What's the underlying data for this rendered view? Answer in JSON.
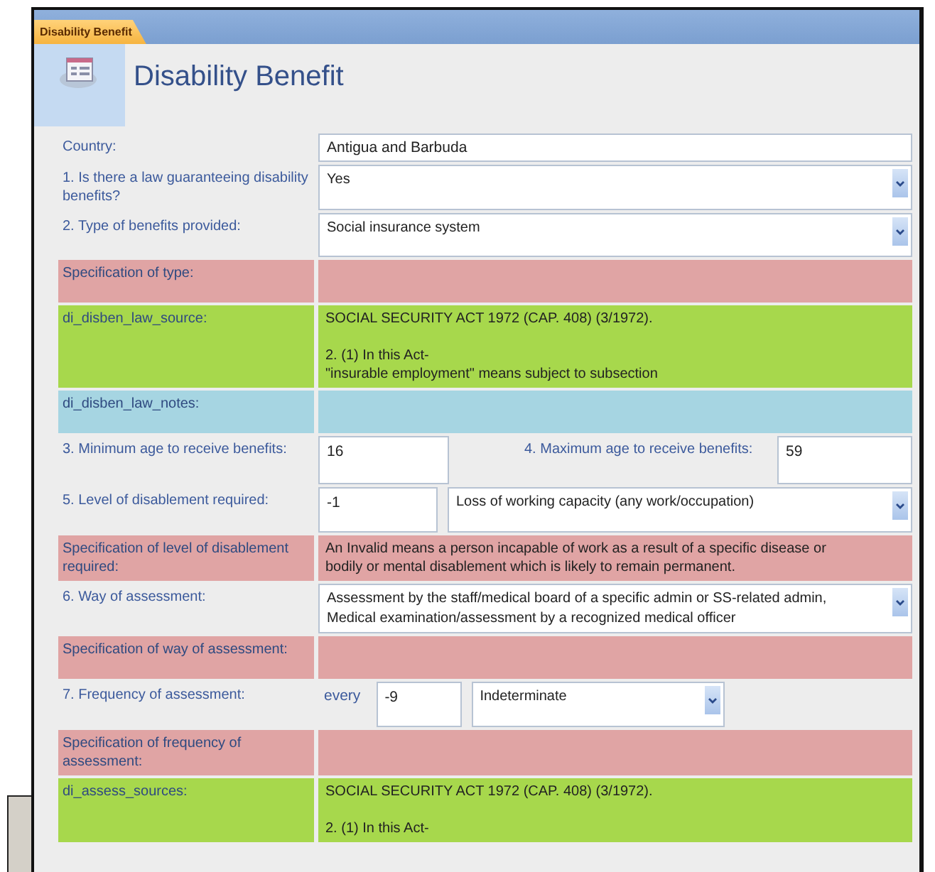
{
  "tab": {
    "label": "Disability Benefit",
    "selected": true
  },
  "form": {
    "title": "Disability Benefit"
  },
  "rows": [
    {
      "kind": "text",
      "label": "Country:",
      "value": "Antigua and Barbuda"
    },
    {
      "kind": "combo",
      "label": "1. Is there a law guaranteeing disability benefits?",
      "value": "Yes"
    },
    {
      "kind": "combo",
      "label": "2. Type of benefits provided:",
      "value": "Social insurance system"
    },
    {
      "kind": "memo",
      "label": "Specification of type:",
      "color": "#e0a4a4"
    },
    {
      "kind": "memo",
      "label": "di_disben_law_source:",
      "color": "#a7d84c",
      "paragraphs": [
        "SOCIAL SECURITY ACT 1972 (CAP. 408) (3/1972).",
        "2. (1) In this Act-\n\"insurable employment\" means subject to subsection"
      ]
    },
    {
      "kind": "memo",
      "label": "di_disben_law_notes:",
      "color": "#a6d5e2"
    },
    {
      "kind": "pair",
      "label": "3. Minimum age to receive benefits:",
      "value": "16",
      "label2": "4. Maximum age to receive benefits:",
      "value2": "59"
    },
    {
      "kind": "level",
      "label": "5. Level of disablement required:",
      "value": "-1",
      "option": "Loss of working capacity (any work/occupation)"
    },
    {
      "kind": "memo",
      "label": "Specification of level of disablement required:",
      "color": "#e0a4a4",
      "paragraphs": [
        "An Invalid means a person incapable of work as a result of a specific disease or\nbodily or mental disablement which is likely to remain permanent."
      ]
    },
    {
      "kind": "combo",
      "label": "6. Way of assessment:",
      "value": "Assessment by the staff/medical board of a specific admin or SS-related admin,\nMedical examination/assessment by a recognized medical officer"
    },
    {
      "kind": "memo",
      "label": "Specification of way of assessment:",
      "color": "#e0a4a4"
    },
    {
      "kind": "freq",
      "label": "7. Frequency of assessment:",
      "prefix": "every",
      "value": "-9",
      "option": "Indeterminate"
    },
    {
      "kind": "memo",
      "label": "Specification of frequency of assessment:",
      "color": "#e0a4a4"
    },
    {
      "kind": "memo",
      "label": "di_assess_sources:",
      "color": "#a7d84c",
      "paragraphs": [
        "SOCIAL SECURITY ACT 1972 (CAP. 408) (3/1972).",
        "2. (1) In this Act-"
      ]
    }
  ]
}
